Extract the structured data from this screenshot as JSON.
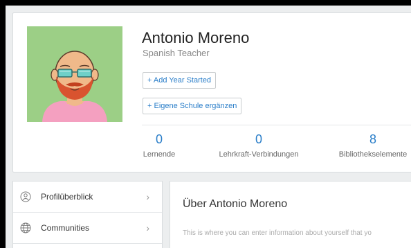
{
  "profile": {
    "name": "Antonio Moreno",
    "role": "Spanish Teacher",
    "add_year_label": "+ Add Year Started",
    "add_school_label": "+ Eigene Schule ergänzen"
  },
  "stats": [
    {
      "value": "0",
      "label": "Lernende"
    },
    {
      "value": "0",
      "label": "Lehrkraft-Verbindungen"
    },
    {
      "value": "8",
      "label": "Bibliothekselemente"
    }
  ],
  "sidebar": {
    "items": [
      {
        "label": "Profilüberblick",
        "icon": "profile-overview-icon"
      },
      {
        "label": "Communities",
        "icon": "globe-icon"
      }
    ]
  },
  "about": {
    "title": "Über Antonio Moreno",
    "placeholder_text": "This is where you can enter information about yourself that yo"
  },
  "colors": {
    "accent": "#2a7ec9",
    "avatar_bg": "#9ccf86"
  }
}
